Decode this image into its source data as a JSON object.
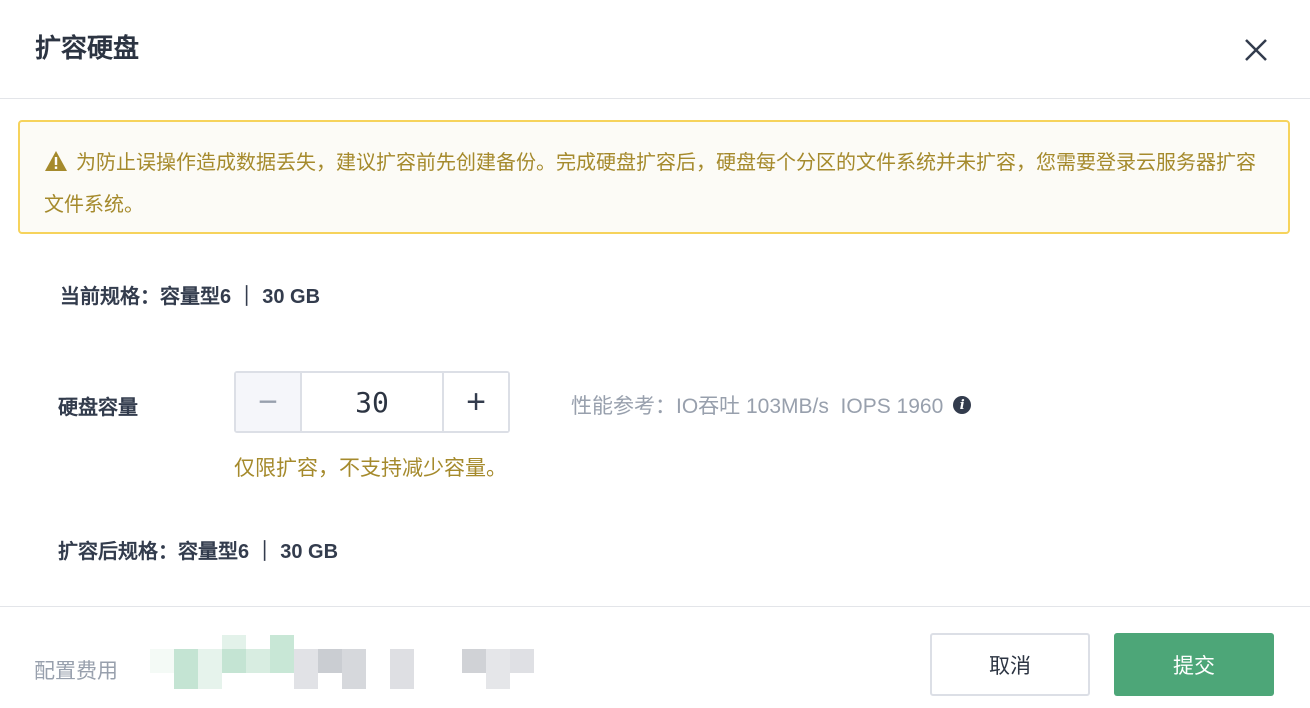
{
  "dialog": {
    "title": "扩容硬盘"
  },
  "alert": {
    "text": "为防止误操作造成数据丢失，建议扩容前先创建备份。完成硬盘扩容后，硬盘每个分区的文件系统并未扩容，您需要登录云服务器扩容文件系统。"
  },
  "current_spec": {
    "label": "当前规格：",
    "value": "容量型6 ｜ 30 GB"
  },
  "capacity": {
    "label": "硬盘容量",
    "value": "30",
    "minus": "−",
    "plus": "+",
    "perf": "性能参考：IO吞吐 103MB/s  IOPS 1960",
    "hint": "仅限扩容，不支持减少容量。"
  },
  "new_spec": {
    "label": "扩容后规格：",
    "value": "容量型6 ｜ 30 GB"
  },
  "footer": {
    "fee_label": "配置费用",
    "cancel": "取消",
    "submit": "提交"
  },
  "colors": {
    "accent": "#4da678",
    "warning": "#a58a2c",
    "warning_border": "#f6d35c"
  }
}
